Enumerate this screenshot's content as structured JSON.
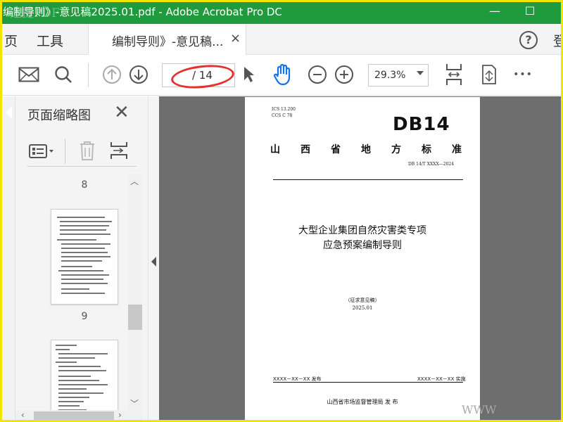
{
  "window": {
    "title": "编制导则》-意见稿2025.01.pdf - Adobe Acrobat Pro DC",
    "watermark": "迅捷PDF",
    "minimize": "—",
    "maximize": "☐"
  },
  "menubar": {
    "home": "页",
    "tools": "工具",
    "tab_label": "编制导则》-意见稿...",
    "tab_close": "×",
    "help": "?",
    "signin": "登"
  },
  "toolbar": {
    "current_page": "",
    "total_pages": "/ 14",
    "zoom": "29.3%",
    "more": "•••"
  },
  "panel": {
    "title": "页面缩略图",
    "close": "✕",
    "thumbnails": [
      {
        "page_label": "8"
      },
      {
        "page_label": "9"
      }
    ]
  },
  "document": {
    "ics": "ICS  13.200",
    "ccs": "CCS  C 78",
    "db_mark": "DB14",
    "province_label": [
      "山",
      "西",
      "省",
      "地",
      "方",
      "标",
      "准"
    ],
    "std_number": "DB 14/T XXXX—2024",
    "title_line1": "大型企业集团自然灾害类专项",
    "title_line2": "应急预案编制导则",
    "draft_note": "（征求意见稿）",
    "draft_date": "2025.01",
    "issue_date": "XXXX－XX－XX 发布",
    "impl_date": "XXXX－XX－XX 实施",
    "issuer": "山西省市场监督管理局    发  布"
  },
  "overlay": {
    "watermark_bottom": "WWW"
  },
  "colors": {
    "titlebar": "#1f9a3c",
    "frame": "#f2e600",
    "accent_blue": "#1473e6",
    "annotation_red": "#e53030",
    "doc_bg": "#6e6e6e"
  }
}
